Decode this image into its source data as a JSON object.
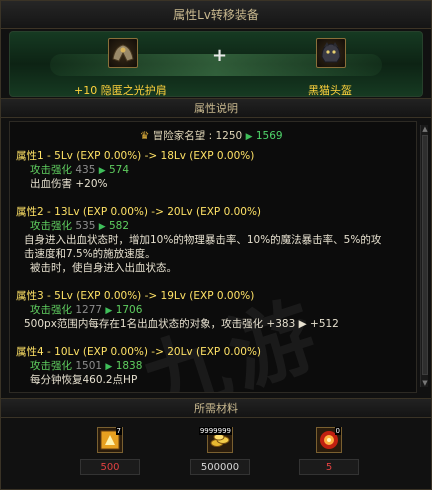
{
  "window": {
    "title": "属性Lv转移装备"
  },
  "transfer": {
    "left_item": "+10 隐匿之光护肩",
    "right_item": "黑猫头盔",
    "plus_symbol": "+"
  },
  "sections": {
    "description_header": "属性说明",
    "materials_header": "所需材料"
  },
  "reputation": {
    "label": "冒险家名望 :",
    "from": "1250",
    "to": "1569"
  },
  "attributes": [
    {
      "head": "属性1 - 5Lv (EXP 0.00%)  ->  18Lv (EXP 0.00%)",
      "sub_label": "攻击强化",
      "sub_from": "435",
      "sub_to": "574",
      "lines": [
        "出血伤害 +20%"
      ]
    },
    {
      "head": "属性2 - 13Lv (EXP 0.00%)  ->  20Lv (EXP 0.00%)",
      "sub_label": "攻击强化",
      "sub_from": "535",
      "sub_to": "582",
      "lines": [
        "自身进入出血状态时，增加10%的物理暴击率、10%的魔法暴击率、5%的攻",
        "击速度和7.5%的施放速度。",
        "被击时，使自身进入出血状态。"
      ]
    },
    {
      "head": "属性3 - 5Lv (EXP 0.00%)  ->  19Lv (EXP 0.00%)",
      "sub_label": "攻击强化",
      "sub_from": "1277",
      "sub_to": "1706",
      "lines": [
        "500px范围内每存在1名出血状态的对象，攻击强化 +383 ▶ +512"
      ]
    },
    {
      "head": "属性4 - 10Lv (EXP 0.00%)  ->  20Lv (EXP 0.00%)",
      "sub_label": "攻击强化",
      "sub_from": "1501",
      "sub_to": "1838",
      "lines": [
        "每分钟恢复460.2点HP"
      ]
    }
  ],
  "materials": [
    {
      "name": "material-1",
      "badge": "7",
      "count": "500",
      "count_color": "#e04040"
    },
    {
      "name": "material-gold",
      "badge": "9999999",
      "count": "500000",
      "count_color": "#d8d8d8"
    },
    {
      "name": "material-3",
      "badge": "0",
      "count": "5",
      "count_color": "#e04040"
    }
  ],
  "icons": {
    "reputation": "crown-icon",
    "arrow": "triangle-right-icon"
  },
  "colors": {
    "accent_gold": "#ffd23c",
    "attr_green": "#5fce5f",
    "arrow_green": "#3fbf5a"
  },
  "watermark": "九游"
}
